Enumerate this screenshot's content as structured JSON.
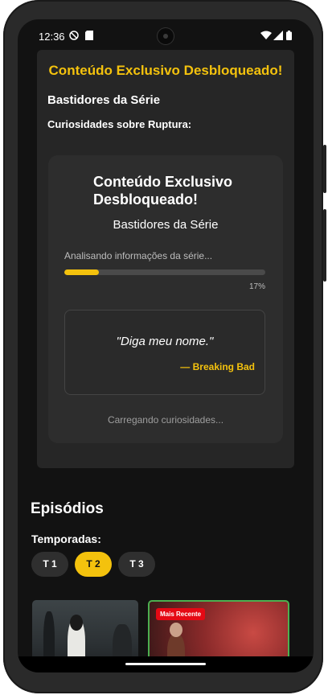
{
  "status_bar": {
    "time": "12:36"
  },
  "unlocked_card": {
    "title": "Conteúdo Exclusivo Desbloqueado!",
    "subtitle": "Bastidores da Série",
    "curiosities_label": "Curiosidades sobre Ruptura:",
    "inner": {
      "title": "Conteúdo Exclusivo Desbloqueado!",
      "subtitle": "Bastidores da Série",
      "progress_label": "Analisando informações da série...",
      "progress_value": 0.17,
      "progress_text": "17%",
      "quote": "\"Diga meu nome.\"",
      "quote_author": "— Breaking Bad",
      "loading_text": "Carregando curiosidades..."
    }
  },
  "episodes": {
    "title": "Episódios",
    "seasons_label": "Temporadas:",
    "seasons": [
      {
        "label": "T 1",
        "active": false
      },
      {
        "label": "T 2",
        "active": true
      },
      {
        "label": "T 3",
        "active": false
      }
    ],
    "badge": "Mais Recente"
  },
  "colors": {
    "accent": "#f4c20d",
    "background": "#121212",
    "card": "#262626",
    "badge": "#e50914",
    "highlight_border": "#4caf50"
  }
}
